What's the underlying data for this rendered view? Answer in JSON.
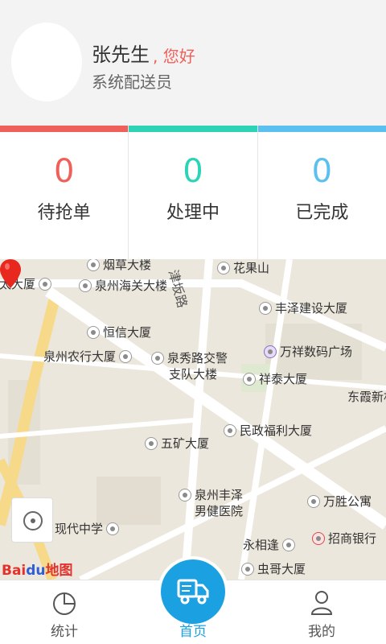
{
  "profile": {
    "name": "张先生",
    "greeting": ", 您好",
    "role": "系统配送员"
  },
  "stats": [
    {
      "label": "待抢单",
      "count": "0",
      "color": "#f0605a"
    },
    {
      "label": "处理中",
      "count": "0",
      "color": "#2ed3b7"
    },
    {
      "label": "已完成",
      "count": "0",
      "color": "#5bc0f0"
    }
  ],
  "map": {
    "pois": [
      {
        "label": "烟草大楼"
      },
      {
        "label": "花果山"
      },
      {
        "label": "泉州海关大楼"
      },
      {
        "label": "丰泽建设大厦"
      },
      {
        "label": "恒信大厦"
      },
      {
        "label": "泉州农行大厦"
      },
      {
        "label": "泉秀路交警"
      },
      {
        "label": "支队大楼"
      },
      {
        "label": "万祥数码广场"
      },
      {
        "label": "祥泰大厦"
      },
      {
        "label": "东霞新村"
      },
      {
        "label": "民政福利大厦"
      },
      {
        "label": "五矿大厦"
      },
      {
        "label": "泉州丰泽"
      },
      {
        "label": "男健医院"
      },
      {
        "label": "万胜公寓"
      },
      {
        "label": "现代中学"
      },
      {
        "label": "永相逢"
      },
      {
        "label": "招商银行"
      },
      {
        "label": "虫哥大厦"
      },
      {
        "label": "丘太大厦"
      }
    ],
    "road_label": "津坂路",
    "logo_text_a": "Bai",
    "logo_text_b": "du",
    "logo_text_c": "地图"
  },
  "nav": {
    "items": [
      {
        "label": "统计",
        "icon": "pie-chart-icon"
      },
      {
        "label": "首页",
        "icon": "delivery-truck-icon"
      },
      {
        "label": "我的",
        "icon": "user-icon"
      }
    ]
  }
}
